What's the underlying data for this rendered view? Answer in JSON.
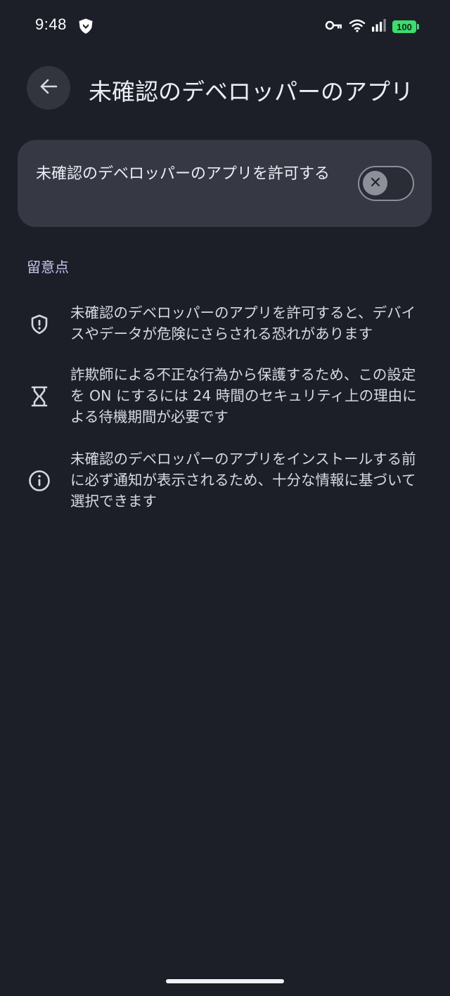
{
  "status_bar": {
    "time": "9:48",
    "battery": "100",
    "icons": [
      "shield-app-icon",
      "key-icon",
      "wifi-icon",
      "signal-icon",
      "battery-icon"
    ]
  },
  "header": {
    "title": "未確認のデベロッパーのアプリ",
    "back_icon": "arrow-left-icon"
  },
  "toggle": {
    "label": "未確認のデベロッパーのアプリを許可する",
    "state": "off",
    "thumb_icon": "close-icon"
  },
  "notes": {
    "heading": "留意点",
    "items": [
      {
        "icon": "shield-alert-icon",
        "text": "未確認のデベロッパーのアプリを許可すると、デバイスやデータが危険にさらされる恐れがあります"
      },
      {
        "icon": "hourglass-icon",
        "text": "詐欺師による不正な行為から保護するため、この設定を ON にするには 24 時間のセキュリティ上の理由による待機期間が必要です"
      },
      {
        "icon": "info-icon",
        "text": "未確認のデベロッパーのアプリをインストールする前に必ず通知が表示されるため、十分な情報に基づいて選択できます"
      }
    ]
  },
  "colors": {
    "background": "#1d1f28",
    "card": "#363844",
    "accent_heading": "#c5c2ea",
    "battery": "#3ddc6e"
  }
}
